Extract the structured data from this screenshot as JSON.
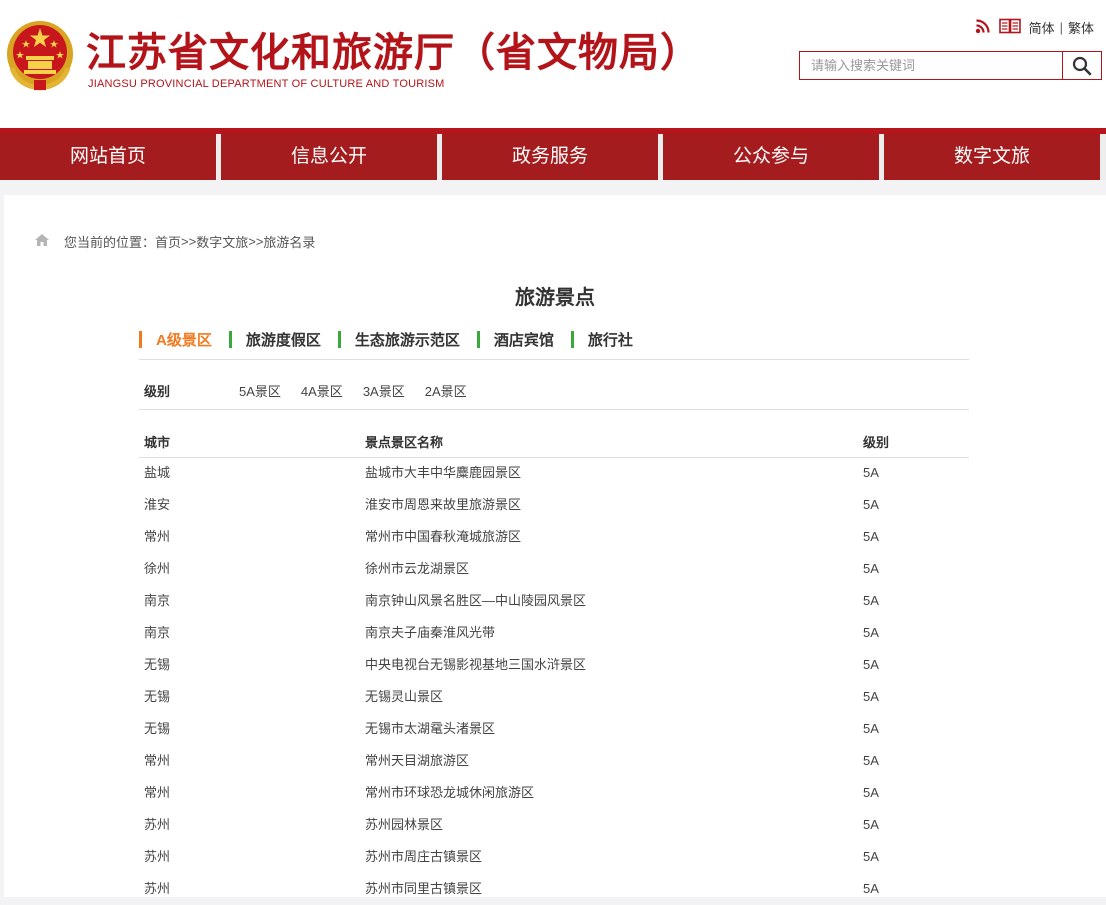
{
  "header": {
    "title_cn": "江苏省文化和旅游厅（省文物局）",
    "title_en": "JIANGSU PROVINCIAL DEPARTMENT OF CULTURE AND TOURISM",
    "links": {
      "simplified": "简体",
      "separator": "|",
      "traditional": "繁体"
    },
    "search": {
      "placeholder": "请输入搜索关键词"
    },
    "icons": [
      "rss-icon",
      "book-icon",
      "search-icon",
      "national-emblem-icon"
    ]
  },
  "nav": {
    "items": [
      "网站首页",
      "信息公开",
      "政务服务",
      "公众参与",
      "数字文旅"
    ]
  },
  "breadcrumb": {
    "prefix": "您当前的位置：",
    "items": [
      "首页",
      ">>",
      "数字文旅",
      ">>",
      "旅游名录"
    ]
  },
  "page_title": "旅游景点",
  "categories": [
    "A级景区",
    "旅游度假区",
    "生态旅游示范区",
    "酒店宾馆",
    "旅行社"
  ],
  "active_category": "A级景区",
  "levels": {
    "label": "级别",
    "options": [
      "5A景区",
      "4A景区",
      "3A景区",
      "2A景区"
    ]
  },
  "table": {
    "headers": [
      "城市",
      "景点景区名称",
      "级别"
    ],
    "rows": [
      [
        "盐城",
        "盐城市大丰中华麋鹿园景区",
        "5A"
      ],
      [
        "淮安",
        "淮安市周恩来故里旅游景区",
        "5A"
      ],
      [
        "常州",
        "常州市中国春秋淹城旅游区",
        "5A"
      ],
      [
        "徐州",
        "徐州市云龙湖景区",
        "5A"
      ],
      [
        "南京",
        "南京钟山风景名胜区—中山陵园风景区",
        "5A"
      ],
      [
        "南京",
        "南京夫子庙秦淮风光带",
        "5A"
      ],
      [
        "无锡",
        "中央电视台无锡影视基地三国水浒景区",
        "5A"
      ],
      [
        "无锡",
        "无锡灵山景区",
        "5A"
      ],
      [
        "无锡",
        "无锡市太湖鼋头渚景区",
        "5A"
      ],
      [
        "常州",
        "常州天目湖旅游区",
        "5A"
      ],
      [
        "常州",
        "常州市环球恐龙城休闲旅游区",
        "5A"
      ],
      [
        "苏州",
        "苏州园林景区",
        "5A"
      ],
      [
        "苏州",
        "苏州市周庄古镇景区",
        "5A"
      ],
      [
        "苏州",
        "苏州市同里古镇景区",
        "5A"
      ]
    ]
  },
  "colors": {
    "brand_red": "#a51c1f",
    "active_orange": "#f07a1f",
    "category_green": "#3aa83a"
  }
}
